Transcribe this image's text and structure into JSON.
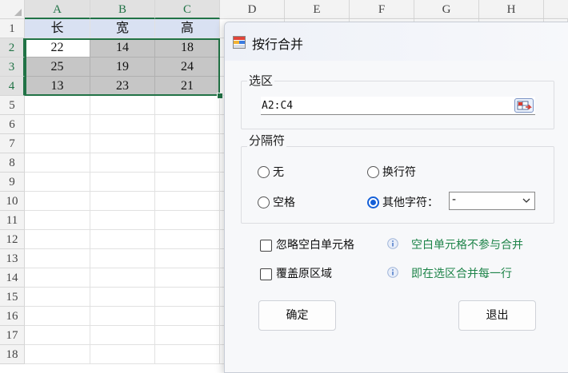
{
  "sheet": {
    "columns": [
      "A",
      "B",
      "C",
      "D",
      "E",
      "F",
      "G",
      "H"
    ],
    "rows": [
      "1",
      "2",
      "3",
      "4",
      "5",
      "6",
      "7",
      "8",
      "9",
      "10",
      "11",
      "12",
      "13",
      "14",
      "15",
      "16",
      "17",
      "18"
    ],
    "header_row": [
      "长",
      "宽",
      "高"
    ],
    "data_rows": [
      [
        "22",
        "14",
        "18"
      ],
      [
        "25",
        "19",
        "24"
      ],
      [
        "13",
        "23",
        "21"
      ]
    ],
    "selection_color": "#217346",
    "header_fill": "#d9e1f2",
    "selected_fill": "#c6c6c6"
  },
  "dialog": {
    "title": "按行合并",
    "icon": "merge-rows-app-icon",
    "range_group": {
      "label": "选区",
      "value": "A2:C4",
      "picker_icon": "range-picker-icon"
    },
    "separator_group": {
      "label": "分隔符",
      "options": {
        "none": "无",
        "newline": "换行符",
        "space": "空格",
        "other": "其他字符："
      },
      "selected": "other",
      "other_value": "-"
    },
    "ignore_blank": {
      "label": "忽略空白单元格",
      "checked": false,
      "hint": "空白单元格不参与合并"
    },
    "overwrite": {
      "label": "覆盖原区域",
      "checked": false,
      "hint": "即在选区合并每一行"
    },
    "ok_label": "确定",
    "exit_label": "退出",
    "hint_color": "#1e8449",
    "accent": "#1560d8"
  }
}
